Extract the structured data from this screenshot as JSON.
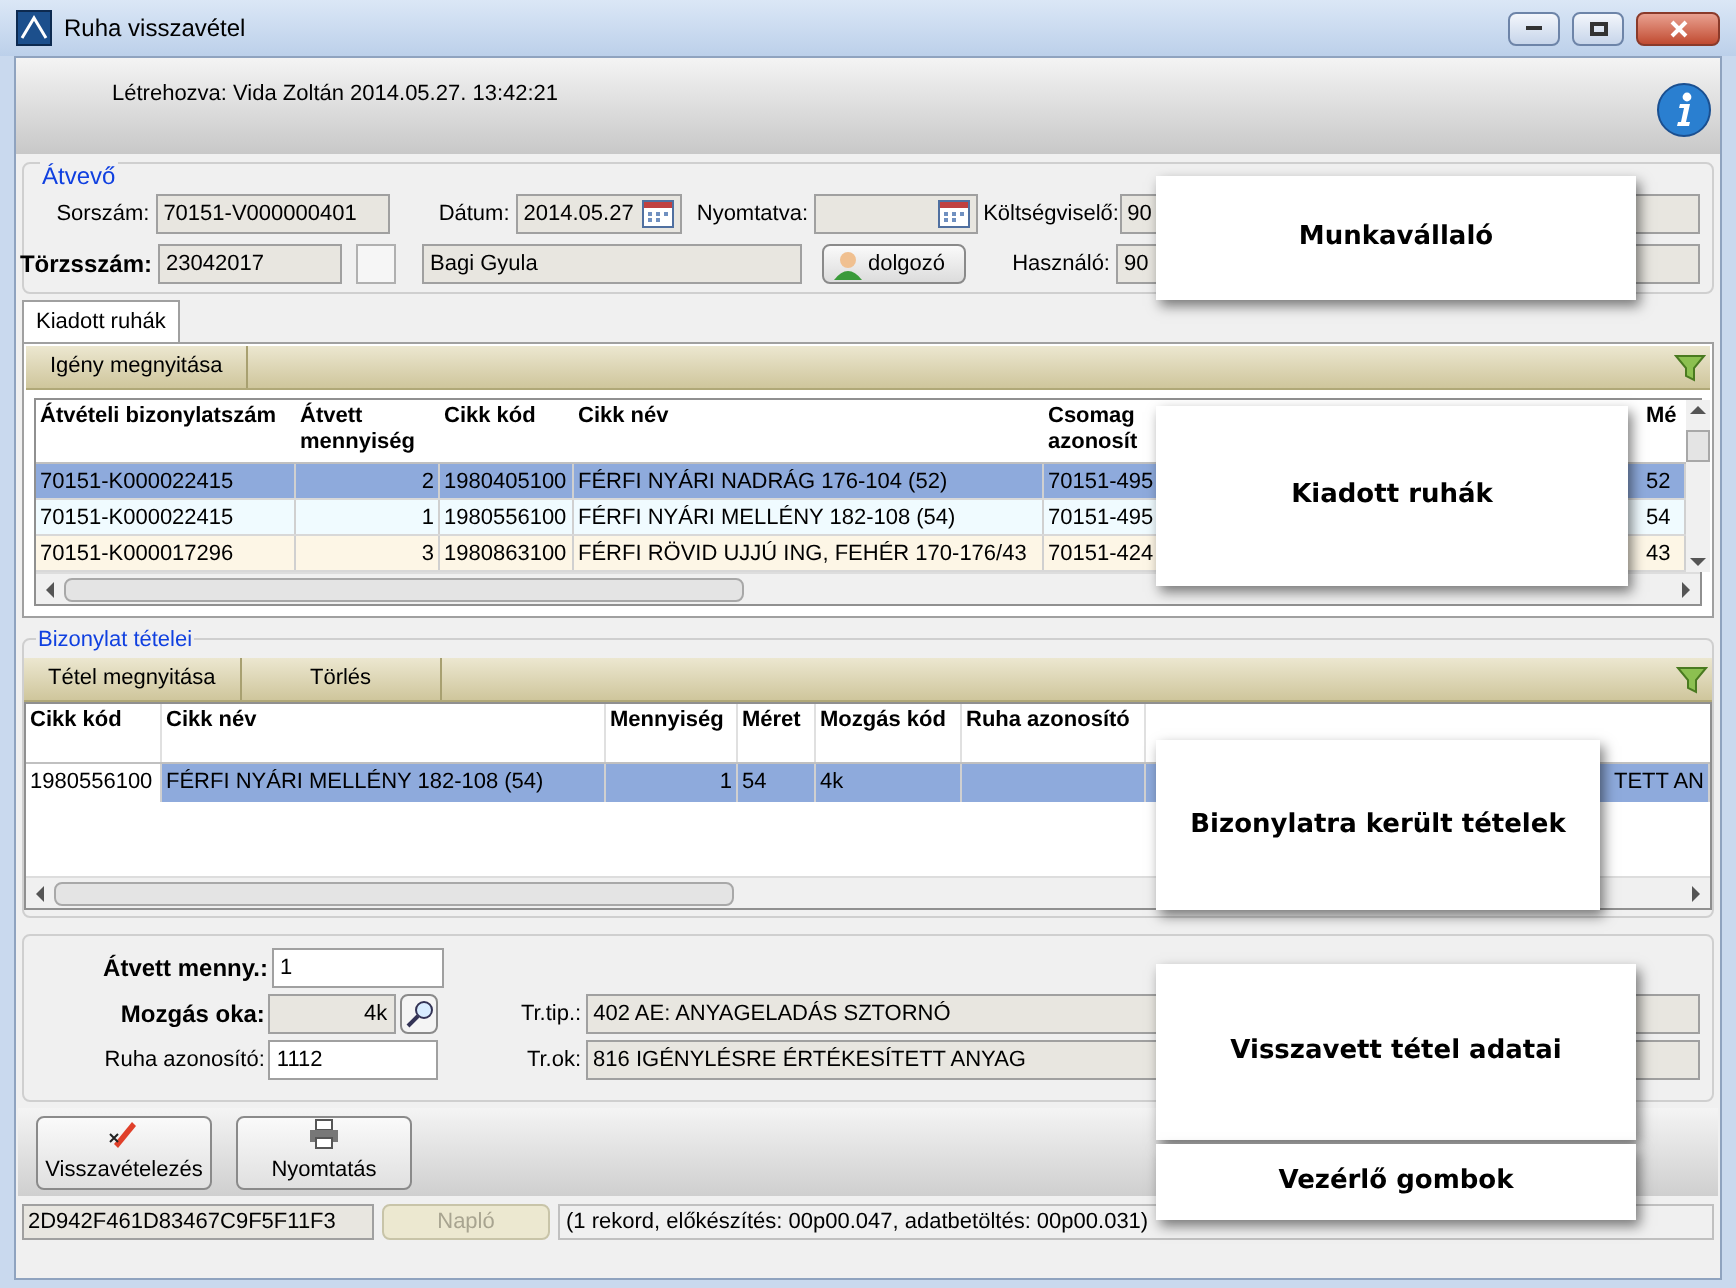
{
  "window": {
    "title": "Ruha visszavétel"
  },
  "header": {
    "created": "Létrehozva: Vida Zoltán 2014.05.27. 13:42:21"
  },
  "atvevo": {
    "title": "Átvevő",
    "sorszam": {
      "label": "Sorszám:",
      "value": "70151-V000000401"
    },
    "datum": {
      "label": "Dátum:",
      "value": "2014.05.27"
    },
    "nyomtatva": {
      "label": "Nyomtatva:"
    },
    "koltsegviselo": {
      "label": "Költségviselő:",
      "value": "90"
    },
    "torzsszam": {
      "label": "Törzsszám:",
      "value": "23042017",
      "checked": false
    },
    "name": {
      "value": "Bagi Gyula"
    },
    "dolgozo_button": "dolgozó",
    "hasznalo": {
      "label": "Használó:",
      "value": "90"
    }
  },
  "tabs": [
    {
      "label": "Kiadott ruhák",
      "selected": true
    }
  ],
  "kiadott": {
    "toolbar": [
      "Igény megnyitása"
    ],
    "columns": [
      "Átvételi bizonylatszám",
      "Átvett mennyiség",
      "Cikk kód",
      "Cikk név",
      "Csomag azonosít",
      "Mé"
    ],
    "rows": [
      {
        "selected": true,
        "cells": [
          "70151-K000022415",
          "2",
          "1980405100",
          "FÉRFI NYÁRI NADRÁG 176-104 (52)",
          "70151-495",
          "52"
        ]
      },
      {
        "selected": false,
        "cells": [
          "70151-K000022415",
          "1",
          "1980556100",
          "FÉRFI NYÁRI MELLÉNY 182-108 (54)",
          "70151-495",
          "54"
        ]
      },
      {
        "selected": false,
        "cells": [
          "70151-K000017296",
          "3",
          "1980863100",
          "FÉRFI RÖVID UJJÚ ING, FEHÉR 170-176/43",
          "70151-424",
          "43"
        ]
      }
    ]
  },
  "tetelek": {
    "title": "Bizonylat tételei",
    "toolbar": [
      "Tétel megnyitása",
      "Törlés"
    ],
    "columns": [
      "Cikk kód",
      "Cikk név",
      "Mennyiség",
      "Méret",
      "Mozgás kód",
      "Ruha azonosító",
      ""
    ],
    "rows": [
      {
        "selected": true,
        "cells": [
          "1980556100",
          "FÉRFI NYÁRI MELLÉNY 182-108 (54)",
          "1",
          "54",
          "4k",
          "",
          "TETT AN"
        ]
      }
    ]
  },
  "details": {
    "atvett": {
      "label": "Átvett menny.:",
      "value": "1"
    },
    "mozgas": {
      "label": "Mozgás oka:",
      "value": "4k"
    },
    "ruha": {
      "label": "Ruha azonosító:",
      "value": "1112"
    },
    "trtip": {
      "label": "Tr.tip.:",
      "value": "402 AE: ANYAGELADÁS SZTORNÓ"
    },
    "trok": {
      "label": "Tr.ok:",
      "value": "816 IGÉNYLÉSRE ÉRTÉKESÍTETT ANYAG"
    }
  },
  "buttons": [
    {
      "label": "Visszavételezés",
      "kind": "pen"
    },
    {
      "label": "Nyomtatás",
      "kind": "printer"
    }
  ],
  "status_bar": {
    "code": "2D942F461D83467C9F5F11F3",
    "log_button": {
      "label": "Napló",
      "disabled": true
    },
    "message": "(1 rekord, előkészítés: 00p00.047, adatbetöltés: 00p00.031)"
  },
  "callouts": [
    "Munkavállaló",
    "Kiadott ruhák",
    "Bizonylatra került tételek",
    "Visszavett tétel adatai",
    "Vezérlő gombok"
  ]
}
